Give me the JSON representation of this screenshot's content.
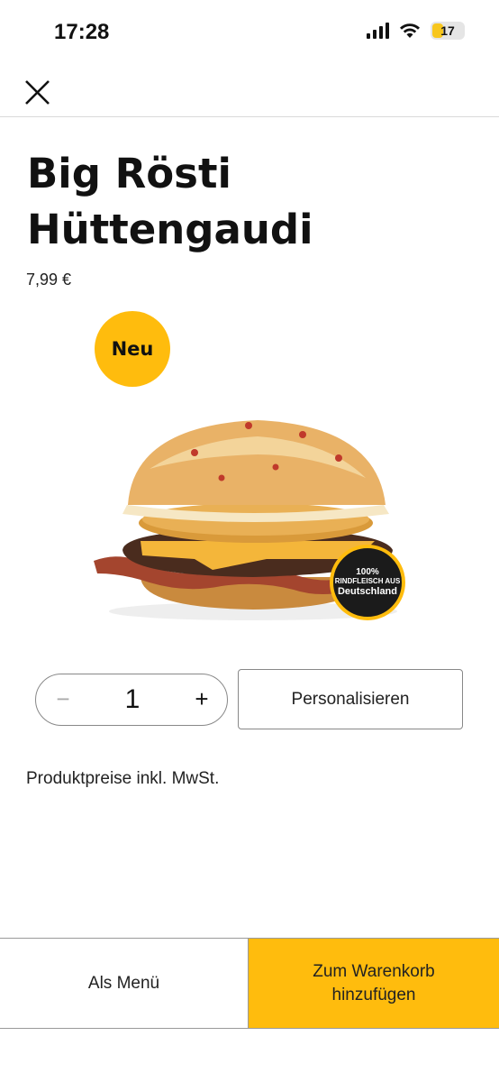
{
  "status_bar": {
    "time": "17:28",
    "battery": "17",
    "icons": [
      "signal-icon",
      "wifi-icon",
      "battery-icon"
    ]
  },
  "nav": {
    "close_icon": "close-icon"
  },
  "product": {
    "title": "Big Rösti Hüttengaudi",
    "price": "7,99 €",
    "badge": "Neu",
    "image": "burger-image",
    "beef_badge": {
      "line1": "100%",
      "line2": "RINDFLEISCH AUS",
      "line3": "Deutschland"
    }
  },
  "quantity": {
    "minus": "−",
    "value": "1",
    "plus": "+"
  },
  "personalize_label": "Personalisieren",
  "tax_note": "Produktpreise inkl. MwSt.",
  "bottom": {
    "menu_label": "Als Menü",
    "cart_label": "Zum Warenkorb hinzufügen"
  },
  "colors": {
    "accent": "#ffbc0d",
    "text": "#222222",
    "border": "#888888"
  }
}
